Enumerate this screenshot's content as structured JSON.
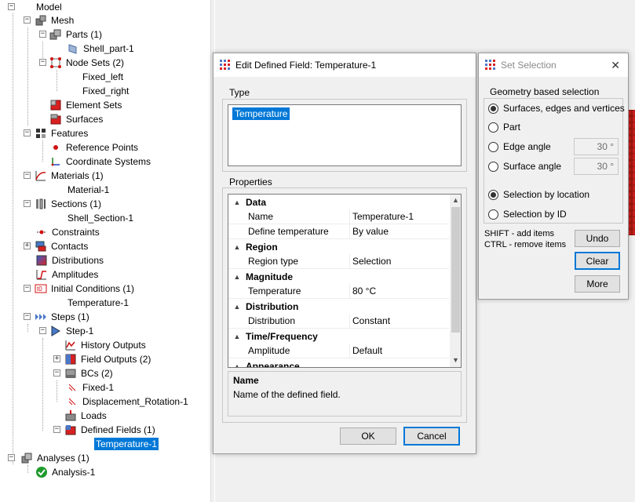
{
  "tree": {
    "model": "Model",
    "mesh": "Mesh",
    "parts": "Parts (1)",
    "shell_part": "Shell_part-1",
    "node_sets": "Node Sets (2)",
    "fixed_left": "Fixed_left",
    "fixed_right": "Fixed_right",
    "element_sets": "Element Sets",
    "surfaces": "Surfaces",
    "features": "Features",
    "reference_points": "Reference Points",
    "coordinate_systems": "Coordinate Systems",
    "materials": "Materials (1)",
    "material_1": "Material-1",
    "sections": "Sections (1)",
    "shell_section": "Shell_Section-1",
    "constraints": "Constraints",
    "contacts": "Contacts",
    "distributions": "Distributions",
    "amplitudes": "Amplitudes",
    "initial_conditions": "Initial Conditions (1)",
    "ic_temperature": "Temperature-1",
    "steps": "Steps (1)",
    "step_1": "Step-1",
    "history_outputs": "History Outputs",
    "field_outputs": "Field Outputs (2)",
    "bcs": "BCs (2)",
    "fixed_1": "Fixed-1",
    "displacement_rotation": "Displacement_Rotation-1",
    "loads": "Loads",
    "defined_fields": "Defined Fields (1)",
    "df_temperature": "Temperature-1",
    "analyses": "Analyses (1)",
    "analysis_1": "Analysis-1"
  },
  "edit_dialog": {
    "title": "Edit Defined Field: Temperature-1",
    "type_group": "Type",
    "type_item": "Temperature",
    "properties_group": "Properties",
    "categories": {
      "data": "Data",
      "region": "Region",
      "magnitude": "Magnitude",
      "distribution": "Distribution",
      "time_frequency": "Time/Frequency",
      "appearance": "Appearance"
    },
    "props": {
      "name_label": "Name",
      "name_value": "Temperature-1",
      "define_label": "Define temperature",
      "define_value": "By value",
      "region_type_label": "Region type",
      "region_type_value": "Selection",
      "temperature_label": "Temperature",
      "temperature_value": "80 °C",
      "distribution_label": "Distribution",
      "distribution_value": "Constant",
      "amplitude_label": "Amplitude",
      "amplitude_value": "Default"
    },
    "description_title": "Name",
    "description_text": "Name of the defined field.",
    "ok": "OK",
    "cancel": "Cancel"
  },
  "set_selection": {
    "title": "Set Selection",
    "geometry_group": "Geometry based selection",
    "opt_surfaces": "Surfaces, edges and vertices",
    "opt_part": "Part",
    "opt_edge_angle": "Edge angle",
    "edge_angle_value": "30 °",
    "opt_surface_angle": "Surface angle",
    "surface_angle_value": "30 °",
    "opt_by_location": "Selection by location",
    "opt_by_id": "Selection by ID",
    "hint_shift": "SHIFT - add items",
    "hint_ctrl": "CTRL - remove items",
    "undo": "Undo",
    "clear": "Clear",
    "more": "More"
  },
  "colors": {
    "selection_blue": "#0078d7",
    "dialog_bg": "#f0f0f0",
    "viewport_bg": "#f0f0f0"
  }
}
